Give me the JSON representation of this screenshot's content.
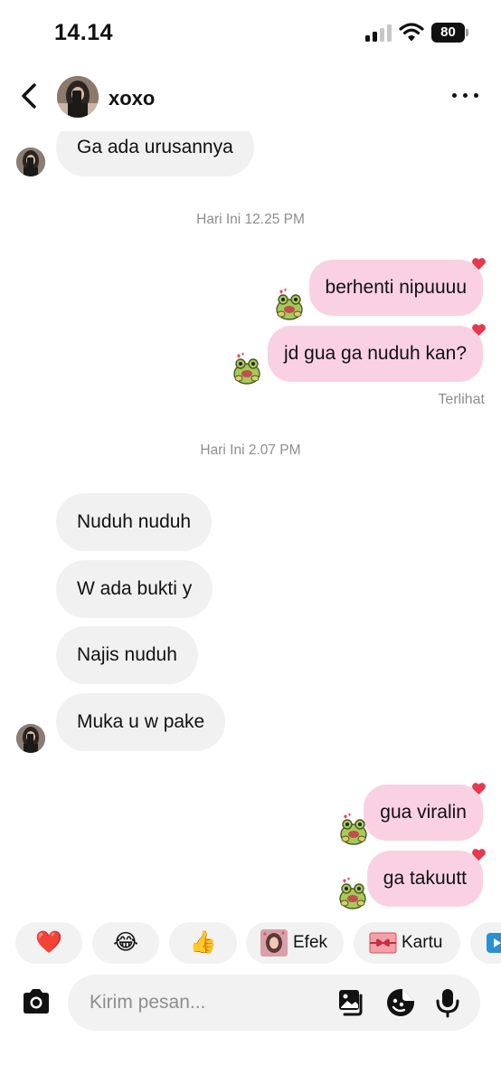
{
  "status": {
    "time": "14.14",
    "battery": "80"
  },
  "header": {
    "contact_name": "xoxo"
  },
  "messages": {
    "in_1": "Ga ada urusannya",
    "time_1": "Hari Ini 12.25 PM",
    "out_1": "berhenti nipuuuu",
    "out_2": "jd gua ga nuduh kan?",
    "seen": "Terlihat",
    "time_2": "Hari Ini 2.07 PM",
    "in_2": "Nuduh nuduh",
    "in_3": "W ada bukti y",
    "in_4": "Najis nuduh",
    "in_5": "Muka u w pake",
    "out_3": "gua viralin",
    "out_4": "ga takuutt"
  },
  "quick_reactions": {
    "heart": "❤️",
    "laugh": "😂",
    "thumbs": "👍",
    "effects_label": "Efek",
    "card_label": "Kartu"
  },
  "composer": {
    "placeholder": "Kirim pesan..."
  },
  "colors": {
    "outgoing_bubble": "#fad1e3",
    "incoming_bubble": "#f1f1f1",
    "react_heart": "#e53950"
  }
}
